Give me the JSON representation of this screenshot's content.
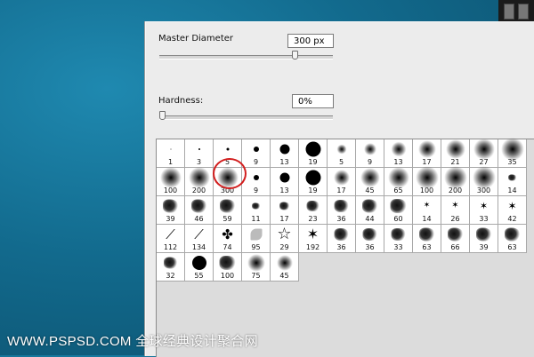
{
  "diameter": {
    "label": "Master Diameter",
    "value": "300 px",
    "slider_fraction": 0.78
  },
  "hardness": {
    "label": "Hardness:",
    "value": "0%",
    "slider_fraction": 0.0
  },
  "brushes": [
    {
      "label": "1",
      "kind": "hard",
      "size": 1
    },
    {
      "label": "3",
      "kind": "hard",
      "size": 2
    },
    {
      "label": "5",
      "kind": "hard",
      "size": 3
    },
    {
      "label": "9",
      "kind": "hard",
      "size": 6
    },
    {
      "label": "13",
      "kind": "hard",
      "size": 11
    },
    {
      "label": "19",
      "kind": "hard",
      "size": 17
    },
    {
      "label": "5",
      "kind": "soft",
      "size": 5
    },
    {
      "label": "9",
      "kind": "soft",
      "size": 8
    },
    {
      "label": "13",
      "kind": "soft",
      "size": 11
    },
    {
      "label": "17",
      "kind": "soft",
      "size": 14
    },
    {
      "label": "21",
      "kind": "soft",
      "size": 16
    },
    {
      "label": "27",
      "kind": "soft",
      "size": 18
    },
    {
      "label": "35",
      "kind": "soft",
      "size": 20
    },
    {
      "label": "100",
      "kind": "soft",
      "size": 18
    },
    {
      "label": "200",
      "kind": "soft",
      "size": 18
    },
    {
      "label": "300",
      "kind": "soft",
      "size": 18
    },
    {
      "label": "9",
      "kind": "hard",
      "size": 6
    },
    {
      "label": "13",
      "kind": "hard",
      "size": 11
    },
    {
      "label": "19",
      "kind": "hard",
      "size": 17
    },
    {
      "label": "17",
      "kind": "soft",
      "size": 12
    },
    {
      "label": "45",
      "kind": "soft",
      "size": 16
    },
    {
      "label": "65",
      "kind": "soft",
      "size": 18
    },
    {
      "label": "100",
      "kind": "soft",
      "size": 20
    },
    {
      "label": "200",
      "kind": "soft",
      "size": 20
    },
    {
      "label": "300",
      "kind": "soft",
      "size": 20
    },
    {
      "label": "14",
      "kind": "splat",
      "size": 7
    },
    {
      "label": "39",
      "kind": "splat",
      "size": 15
    },
    {
      "label": "46",
      "kind": "splat",
      "size": 15
    },
    {
      "label": "59",
      "kind": "splat",
      "size": 15
    },
    {
      "label": "11",
      "kind": "splat",
      "size": 7
    },
    {
      "label": "17",
      "kind": "splat",
      "size": 9
    },
    {
      "label": "23",
      "kind": "splat",
      "size": 12
    },
    {
      "label": "36",
      "kind": "splat",
      "size": 14
    },
    {
      "label": "44",
      "kind": "splat",
      "size": 15
    },
    {
      "label": "60",
      "kind": "splat",
      "size": 16
    },
    {
      "label": "14",
      "kind": "star",
      "size": 5
    },
    {
      "label": "26",
      "kind": "star",
      "size": 6
    },
    {
      "label": "33",
      "kind": "star",
      "size": 7
    },
    {
      "label": "42",
      "kind": "star",
      "size": 8
    },
    {
      "label": "112",
      "kind": "grass",
      "size": 16
    },
    {
      "label": "134",
      "kind": "grass",
      "size": 16
    },
    {
      "label": "74",
      "kind": "maple",
      "size": 14
    },
    {
      "label": "95",
      "kind": "leaf",
      "size": 14
    },
    {
      "label": "29",
      "kind": "outline-star",
      "size": 16
    },
    {
      "label": "192",
      "kind": "star",
      "size": 12
    },
    {
      "label": "36",
      "kind": "splat",
      "size": 14
    },
    {
      "label": "36",
      "kind": "splat",
      "size": 14
    },
    {
      "label": "33",
      "kind": "splat",
      "size": 14
    },
    {
      "label": "63",
      "kind": "splat",
      "size": 15
    },
    {
      "label": "66",
      "kind": "splat",
      "size": 15
    },
    {
      "label": "39",
      "kind": "splat",
      "size": 15
    },
    {
      "label": "63",
      "kind": "splat",
      "size": 15
    },
    {
      "label": "32",
      "kind": "splat",
      "size": 13
    },
    {
      "label": "55",
      "kind": "hard",
      "size": 16
    },
    {
      "label": "100",
      "kind": "splat",
      "size": 16
    },
    {
      "label": "75",
      "kind": "soft",
      "size": 14
    },
    {
      "label": "45",
      "kind": "soft",
      "size": 12
    }
  ],
  "selected_brush_index": 15,
  "selection_color": "#d21e1e",
  "watermark": "WWW.PSPSD.COM 全球经典设计聚合网"
}
